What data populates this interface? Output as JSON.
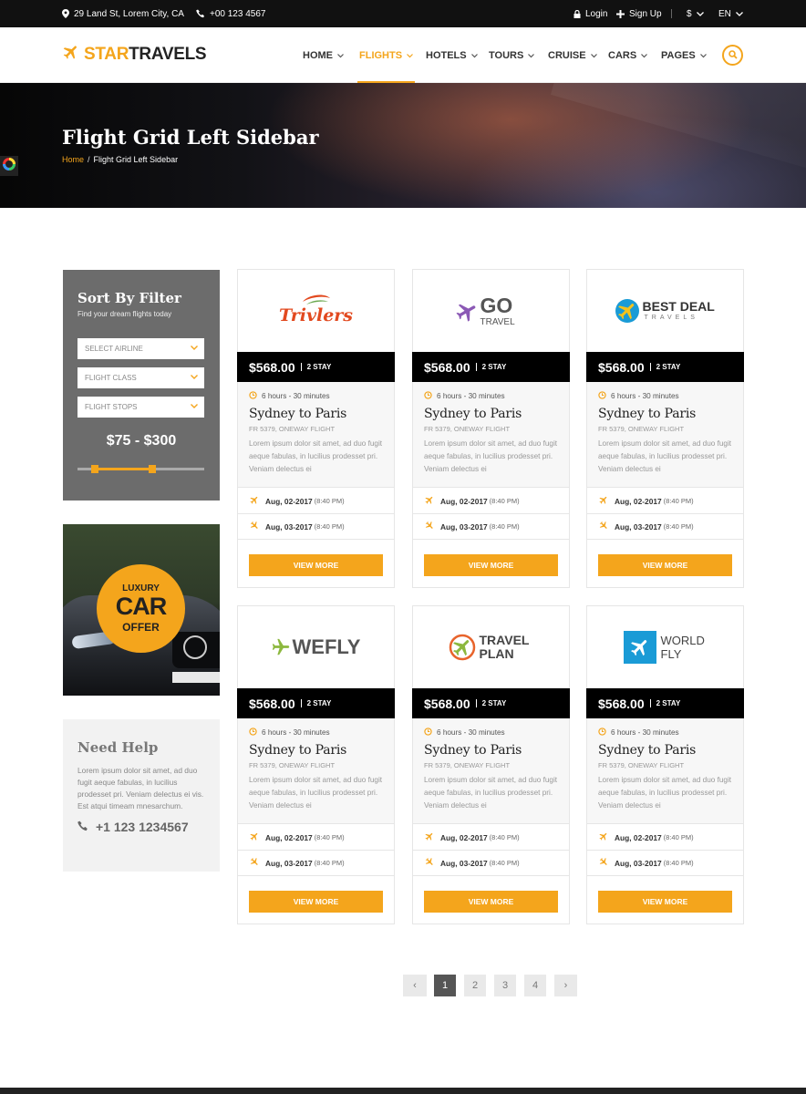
{
  "topbar": {
    "address": "29 Land St, Lorem City, CA",
    "phone": "+00 123 4567",
    "login": "Login",
    "signup": "Sign Up",
    "currency": "$",
    "language": "EN"
  },
  "header": {
    "logo_star": "STAR",
    "logo_travels": "TRAVELS",
    "nav": [
      {
        "label": "HOME",
        "active": false
      },
      {
        "label": "FLIGHTS",
        "active": true
      },
      {
        "label": "HOTELS",
        "active": false
      },
      {
        "label": "TOURS",
        "active": false
      },
      {
        "label": "CRUISE",
        "active": false
      },
      {
        "label": "CARS",
        "active": false
      },
      {
        "label": "PAGES",
        "active": false
      }
    ]
  },
  "hero": {
    "title": "Flight Grid Left Sidebar",
    "breadcrumb_home": "Home",
    "breadcrumb_sep": "/",
    "breadcrumb_current": "Flight Grid Left Sidebar"
  },
  "filter": {
    "title": "Sort By Filter",
    "subtitle": "Find your dream flights today",
    "selects": [
      "SELECT AIRLINE",
      "FLIGHT CLASS",
      "FLIGHT STOPS"
    ],
    "price_range": "$75 - $300",
    "range_low_fraction": 0.14,
    "range_high_fraction": 0.59
  },
  "offer": {
    "line1": "LUXURY",
    "line2": "CAR",
    "line3": "OFFER"
  },
  "help": {
    "title": "Need Help",
    "text": "Lorem ipsum dolor sit amet, ad duo fugit aeque fabulas, in lucilius prodesset pri. Veniam delectus ei vis. Est atqui timeam mnesarchum.",
    "phone": "+1 123 1234567"
  },
  "cards": [
    {
      "brand": "Trivlers",
      "price": "$568.00",
      "stay": "2 STAY",
      "duration": "6 hours - 30 minutes",
      "route": "Sydney to Paris",
      "code": "FR 5379, ONEWAY FLIGHT",
      "desc": "Lorem ipsum dolor sit amet, ad duo fugit aeque fabulas, in lucilius prodesset pri. Veniam delectus ei",
      "depart_date": "Aug, 02-2017",
      "depart_time": "(8:40 PM)",
      "arrive_date": "Aug, 03-2017",
      "arrive_time": "(8:40 PM)",
      "button": "VIEW MORE"
    },
    {
      "brand_main": "GO",
      "brand_sub": "TRAVEL",
      "price": "$568.00",
      "stay": "2 STAY",
      "duration": "6 hours - 30 minutes",
      "route": "Sydney to Paris",
      "code": "FR 5379, ONEWAY FLIGHT",
      "desc": "Lorem ipsum dolor sit amet, ad duo fugit aeque fabulas, in lucilius prodesset pri. Veniam delectus ei",
      "depart_date": "Aug, 02-2017",
      "depart_time": "(8:40 PM)",
      "arrive_date": "Aug, 03-2017",
      "arrive_time": "(8:40 PM)",
      "button": "VIEW MORE"
    },
    {
      "brand_main": "BEST DEAL",
      "brand_sub": "TRAVELS",
      "price": "$568.00",
      "stay": "2 STAY",
      "duration": "6 hours - 30 minutes",
      "route": "Sydney to Paris",
      "code": "FR 5379, ONEWAY FLIGHT",
      "desc": "Lorem ipsum dolor sit amet, ad duo fugit aeque fabulas, in lucilius prodesset pri. Veniam delectus ei",
      "depart_date": "Aug, 02-2017",
      "depart_time": "(8:40 PM)",
      "arrive_date": "Aug, 03-2017",
      "arrive_time": "(8:40 PM)",
      "button": "VIEW MORE"
    },
    {
      "brand_main": "WEFLY",
      "price": "$568.00",
      "stay": "2 STAY",
      "duration": "6 hours - 30 minutes",
      "route": "Sydney to Paris",
      "code": "FR 5379, ONEWAY FLIGHT",
      "desc": "Lorem ipsum dolor sit amet, ad duo fugit aeque fabulas, in lucilius prodesset pri. Veniam delectus ei",
      "depart_date": "Aug, 02-2017",
      "depart_time": "(8:40 PM)",
      "arrive_date": "Aug, 03-2017",
      "arrive_time": "(8:40 PM)",
      "button": "VIEW MORE"
    },
    {
      "brand_main": "TRAVEL",
      "brand_sub": "PLAN",
      "price": "$568.00",
      "stay": "2 STAY",
      "duration": "6 hours - 30 minutes",
      "route": "Sydney to Paris",
      "code": "FR 5379, ONEWAY FLIGHT",
      "desc": "Lorem ipsum dolor sit amet, ad duo fugit aeque fabulas, in lucilius prodesset pri. Veniam delectus ei",
      "depart_date": "Aug, 02-2017",
      "depart_time": "(8:40 PM)",
      "arrive_date": "Aug, 03-2017",
      "arrive_time": "(8:40 PM)",
      "button": "VIEW MORE"
    },
    {
      "brand_main": "WORLD",
      "brand_sub": "FLY",
      "price": "$568.00",
      "stay": "2 STAY",
      "duration": "6 hours - 30 minutes",
      "route": "Sydney to Paris",
      "code": "FR 5379, ONEWAY FLIGHT",
      "desc": "Lorem ipsum dolor sit amet, ad duo fugit aeque fabulas, in lucilius prodesset pri. Veniam delectus ei",
      "depart_date": "Aug, 02-2017",
      "depart_time": "(8:40 PM)",
      "arrive_date": "Aug, 03-2017",
      "arrive_time": "(8:40 PM)",
      "button": "VIEW MORE"
    }
  ],
  "pagination": {
    "prev": "‹",
    "pages": [
      "1",
      "2",
      "3",
      "4"
    ],
    "current": "1",
    "next": "›"
  },
  "colors": {
    "accent": "#f4a51c",
    "dark": "#000000",
    "topbar": "#111111",
    "filter_bg": "#6c6c6c"
  }
}
